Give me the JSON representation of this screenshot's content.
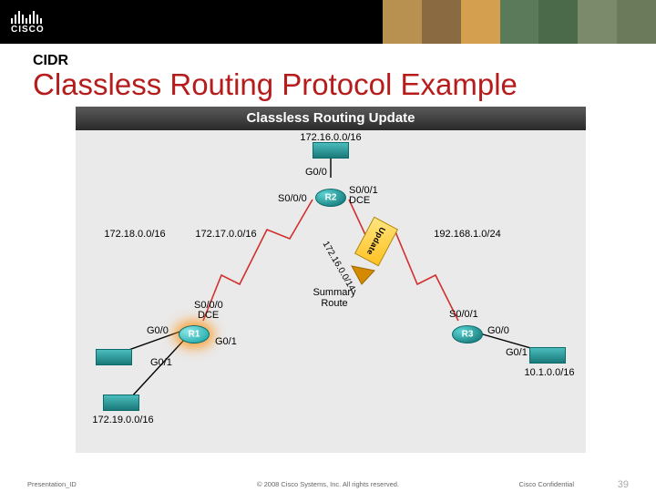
{
  "header": {
    "brand": "CISCO"
  },
  "slide": {
    "kicker": "CIDR",
    "title": "Classless Routing Protocol Example"
  },
  "diagram": {
    "title": "Classless Routing Update",
    "routers": {
      "r1": "R1",
      "r2": "R2",
      "r3": "R3"
    },
    "networks": {
      "r2_top": "172.16.0.0/16",
      "r1_left1": "172.18.0.0/16",
      "r1_left2": "172.17.0.0/16",
      "r1_bottom": "172.19.0.0/16",
      "r3_right_top": "192.168.1.0/24",
      "r3_right": "10.1.0.0/16"
    },
    "interfaces": {
      "r2_g00": "G0/0",
      "r2_s000": "S0/0/0",
      "r2_s001": "S0/0/1",
      "r2_dce": "DCE",
      "r1_s000": "S0/0/0",
      "r1_dce": "DCE",
      "r1_g00": "G0/0",
      "r1_g01_left": "G0/1",
      "r1_g01_right": "G0/1",
      "r3_s001": "S0/0/1",
      "r3_g00": "G0/0",
      "r3_g01": "G0/1"
    },
    "annotations": {
      "update": "Update",
      "summary_route": "Summary\nRoute",
      "summary_prefix": "172.16.0.0/14"
    }
  },
  "footer": {
    "left": "Presentation_ID",
    "center": "© 2008 Cisco Systems, Inc. All rights reserved.",
    "right": "Cisco Confidential",
    "page": "39"
  }
}
